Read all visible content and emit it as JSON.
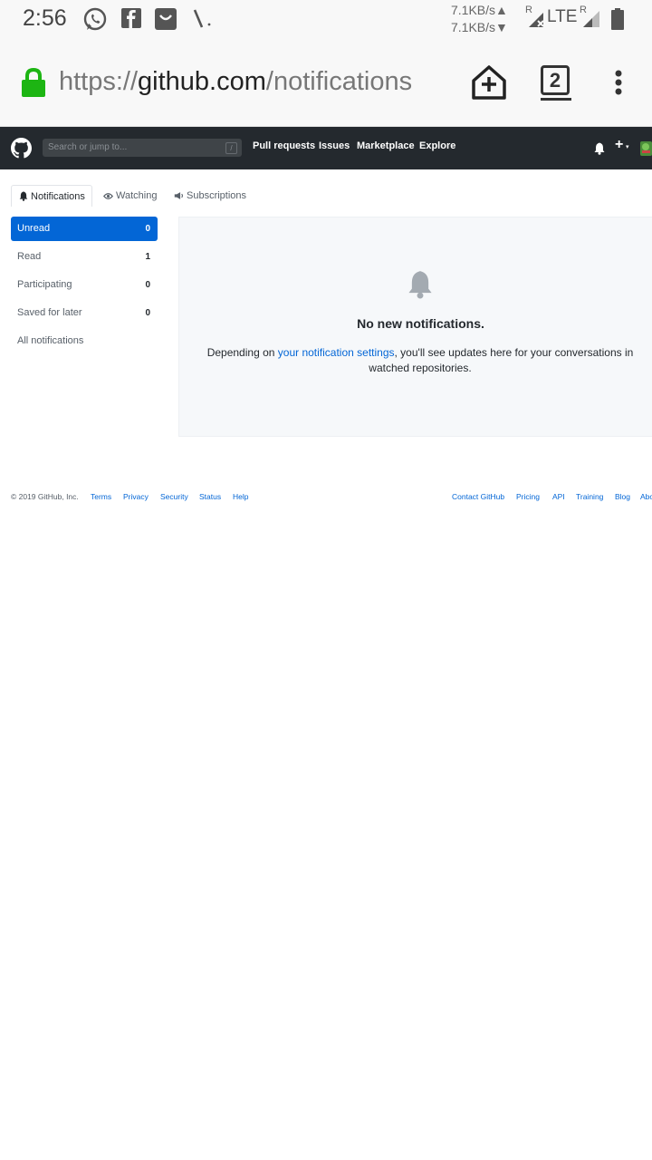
{
  "status_bar": {
    "time": "2:56",
    "speed_up": "7.1KB/s",
    "speed_down": "7.1KB/s",
    "network": "LTE",
    "roaming_label": "R",
    "notification_icons": [
      "whatsapp-icon",
      "facebook-icon",
      "shopping-bag-icon",
      "pen-icon"
    ]
  },
  "browser": {
    "url_scheme": "https://",
    "url_host": "github.com",
    "url_path": "/notifications",
    "tab_count": "2",
    "lock_color": "#1db513"
  },
  "header": {
    "search_placeholder": "Search or jump to...",
    "search_shortcut": "/",
    "nav": [
      "Pull requests",
      "Issues",
      "Marketplace",
      "Explore"
    ],
    "plus": "+",
    "caret": "▾"
  },
  "subtabs": {
    "notifications": "Notifications",
    "watching": "Watching",
    "subscriptions": "Subscriptions"
  },
  "filters": [
    {
      "label": "Unread",
      "count": "0"
    },
    {
      "label": "Read",
      "count": "1"
    },
    {
      "label": "Participating",
      "count": "0"
    },
    {
      "label": "Saved for later",
      "count": "0"
    },
    {
      "label": "All notifications",
      "count": ""
    }
  ],
  "blankslate": {
    "title": "No new notifications.",
    "text_before": "Depending on ",
    "link": "your notification settings",
    "text_after": ", you'll see updates here for your conversations in watched repositories."
  },
  "footer": {
    "copyright": "© 2019 GitHub, Inc.",
    "left_links": [
      "Terms",
      "Privacy",
      "Security",
      "Status",
      "Help"
    ],
    "right_links": [
      "Contact GitHub",
      "Pricing",
      "API",
      "Training",
      "Blog",
      "Abo"
    ]
  },
  "colors": {
    "accent": "#0366d6",
    "header_bg": "#24292e"
  }
}
